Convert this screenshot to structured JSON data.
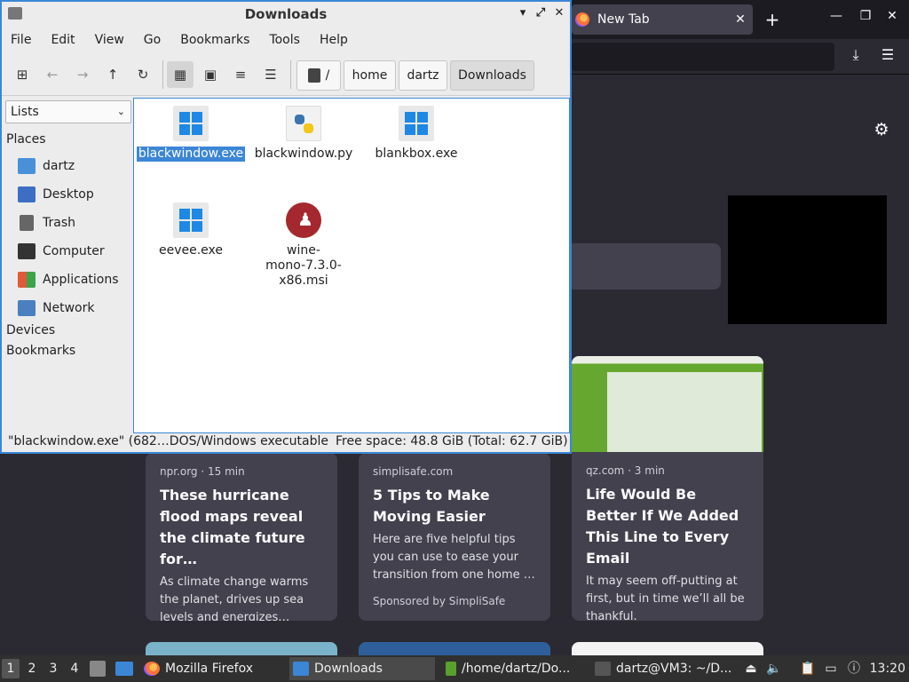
{
  "firefox": {
    "tab_title": "New Tab",
    "tab_close": "✕",
    "new_tab": "+",
    "win_min": "—",
    "win_max": "❐",
    "win_close": "✕",
    "download_icon": "⤓",
    "menu_icon": "☰",
    "settings_icon": "⚙",
    "cards": [
      {
        "source": "npr.org · 15 min",
        "title": "These hurricane flood maps reveal the climate future for…",
        "desc": "As climate change warms the planet, drives up sea levels and energizes…",
        "sponsor": ""
      },
      {
        "source": "simplisafe.com",
        "title": "5 Tips to Make Moving Easier",
        "desc": "Here are five helpful tips you can use to ease your transition from one home …",
        "sponsor": "Sponsored by SimpliSafe"
      },
      {
        "source": "qz.com · 3 min",
        "title": "Life Would Be Better If We Added This Line to Every Email",
        "desc": "It may seem off-putting at first, but in time we’ll all be thankful.",
        "sponsor": ""
      }
    ]
  },
  "filemanager": {
    "title": "Downloads",
    "controls": {
      "min": "▾",
      "max": "⤢",
      "close": "✕"
    },
    "menu": [
      "File",
      "Edit",
      "View",
      "Go",
      "Bookmarks",
      "Tools",
      "Help"
    ],
    "toolbar": {
      "new_window_icon": "⊞",
      "back_icon": "←",
      "forward_icon": "→",
      "up_icon": "↑",
      "reload_icon": "↻",
      "icon_view_icon": "▦",
      "thumb_view_icon": "▣",
      "compact_view_icon": "≡",
      "list_view_icon": "☰"
    },
    "breadcrumb": [
      "/",
      "home",
      "dartz",
      "Downloads"
    ],
    "sidebar": {
      "mode": "Lists",
      "places_label": "Places",
      "places": [
        {
          "label": "dartz",
          "color": "#4a90d9"
        },
        {
          "label": "Desktop",
          "color": "#3c6fc4"
        },
        {
          "label": "Trash",
          "color": "#666666"
        },
        {
          "label": "Computer",
          "color": "#333333"
        },
        {
          "label": "Applications",
          "color": "#e05a3a"
        },
        {
          "label": "Network",
          "color": "#4a7fc0"
        }
      ],
      "devices_label": "Devices",
      "bookmarks_label": "Bookmarks"
    },
    "files": [
      {
        "name": "blackwindow.exe",
        "type": "exe",
        "selected": true
      },
      {
        "name": "blackwindow.py",
        "type": "py",
        "selected": false
      },
      {
        "name": "blankbox.exe",
        "type": "exe",
        "selected": false
      },
      {
        "name": "eevee.exe",
        "type": "exe",
        "selected": false
      },
      {
        "name": "wine-\nmono-7.3.0-\nx86.msi",
        "type": "msi",
        "selected": false
      }
    ],
    "status": {
      "left": "\"blackwindow.exe\" (682…DOS/Windows executable",
      "right": "Free space: 48.8 GiB (Total: 62.7 GiB)"
    }
  },
  "taskbar": {
    "workspaces": [
      "1",
      "2",
      "3",
      "4"
    ],
    "tasks": [
      "Mozilla Firefox",
      "Downloads",
      "/home/dartz/Do...",
      "dartz@VM3: ~/D..."
    ],
    "clock": "13:20"
  }
}
